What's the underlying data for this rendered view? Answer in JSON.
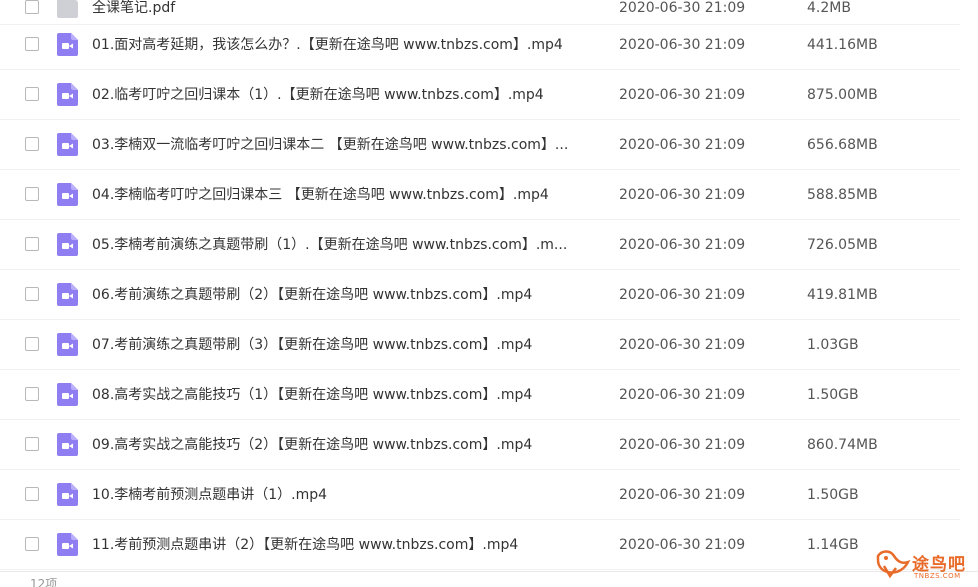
{
  "top_partial": {
    "name": "全课笔记.pdf",
    "date": "2020-06-30 21:09",
    "size": "4.2MB"
  },
  "files": [
    {
      "name": "01.面对高考延期，我该怎么办？.【更新在途鸟吧 www.tnbzs.com】.mp4",
      "date": "2020-06-30 21:09",
      "size": "441.16MB",
      "icon": "video-file-icon"
    },
    {
      "name": "02.临考叮咛之回归课本（1）.【更新在途鸟吧 www.tnbzs.com】.mp4",
      "date": "2020-06-30 21:09",
      "size": "875.00MB",
      "icon": "video-file-icon"
    },
    {
      "name": "03.李楠双一流临考叮咛之回归课本二 【更新在途鸟吧 www.tnbzs.com】...",
      "date": "2020-06-30 21:09",
      "size": "656.68MB",
      "icon": "video-file-icon"
    },
    {
      "name": "04.李楠临考叮咛之回归课本三 【更新在途鸟吧 www.tnbzs.com】.mp4",
      "date": "2020-06-30 21:09",
      "size": "588.85MB",
      "icon": "video-file-icon"
    },
    {
      "name": "05.李楠考前演练之真题带刷（1）.【更新在途鸟吧 www.tnbzs.com】.m...",
      "date": "2020-06-30 21:09",
      "size": "726.05MB",
      "icon": "video-file-icon"
    },
    {
      "name": "06.考前演练之真题带刷（2）【更新在途鸟吧 www.tnbzs.com】.mp4",
      "date": "2020-06-30 21:09",
      "size": "419.81MB",
      "icon": "video-file-icon"
    },
    {
      "name": "07.考前演练之真题带刷（3）【更新在途鸟吧 www.tnbzs.com】.mp4",
      "date": "2020-06-30 21:09",
      "size": "1.03GB",
      "icon": "video-file-icon"
    },
    {
      "name": "08.高考实战之高能技巧（1）【更新在途鸟吧 www.tnbzs.com】.mp4",
      "date": "2020-06-30 21:09",
      "size": "1.50GB",
      "icon": "video-file-icon"
    },
    {
      "name": "09.高考实战之高能技巧（2）【更新在途鸟吧 www.tnbzs.com】.mp4",
      "date": "2020-06-30 21:09",
      "size": "860.74MB",
      "icon": "video-file-icon"
    },
    {
      "name": "10.李楠考前预测点题串讲（1）.mp4",
      "date": "2020-06-30 21:09",
      "size": "1.50GB",
      "icon": "video-file-icon"
    },
    {
      "name": "11.考前预测点题串讲（2）【更新在途鸟吧 www.tnbzs.com】.mp4",
      "date": "2020-06-30 21:09",
      "size": "1.14GB",
      "icon": "video-file-icon"
    }
  ],
  "footer": {
    "text": "12项"
  },
  "watermark": {
    "cn": "途鸟吧",
    "en": "TNBZS.COM",
    "icon": "bird-logo-icon"
  },
  "colors": {
    "icon_purple": "#8f7ef1",
    "watermark_orange": "#e86b2a",
    "divider": "#f0f0f0"
  }
}
